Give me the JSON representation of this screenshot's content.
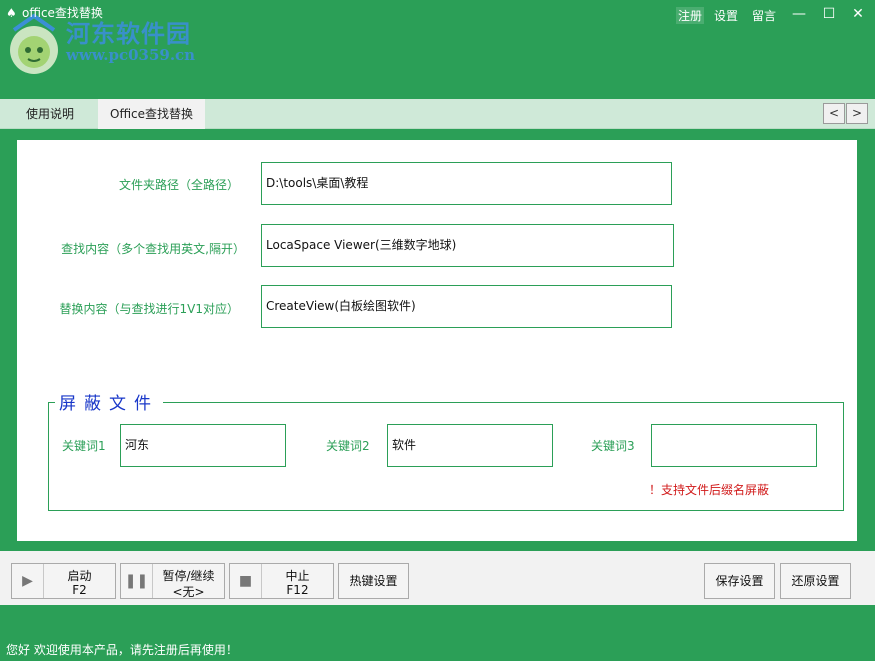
{
  "titlebar": {
    "title": "office查找替换",
    "watermark_name": "河东软件园",
    "watermark_url": "www.pc0359.cn",
    "links": [
      "注册",
      "设置",
      "留言"
    ],
    "min_glyph": "—",
    "max_glyph": "☐",
    "close_glyph": "✕"
  },
  "tabs": {
    "items": [
      "使用说明",
      "Office查找替换"
    ],
    "prev": "<",
    "next": ">"
  },
  "form": {
    "folder_label": "文件夹路径（全路径）",
    "folder_value": "D:\\tools\\桌面\\教程",
    "find_label": "查找内容（多个查找用英文,隔开）",
    "find_value": "LocaSpace Viewer(三维数字地球)",
    "replace_label": "替换内容（与查找进行1V1对应）",
    "replace_value": "CreateView(白板绘图软件)"
  },
  "mask": {
    "title": "屏蔽文件",
    "kw1_label": "关键词1",
    "kw1_value": "河东",
    "kw2_label": "关键词2",
    "kw2_value": "软件",
    "kw3_label": "关键词3",
    "kw3_value": "",
    "note": "！支持文件后缀名屏蔽"
  },
  "toolbar": {
    "start_label": "启动",
    "start_key": "F2",
    "pause_label": "暂停/继续",
    "pause_key": "<无>",
    "stop_label": "中止",
    "stop_key": "F12",
    "hotkey_label": "热键设置",
    "save_label": "保存设置",
    "restore_label": "还原设置"
  },
  "status": {
    "text": "您好 欢迎使用本产品，请先注册后再使用！"
  },
  "colors": {
    "brand_green": "#2b9f57",
    "tab_strip": "#cfe9d8",
    "group_title_blue": "#1a38c9",
    "note_red": "#d11a1a"
  }
}
